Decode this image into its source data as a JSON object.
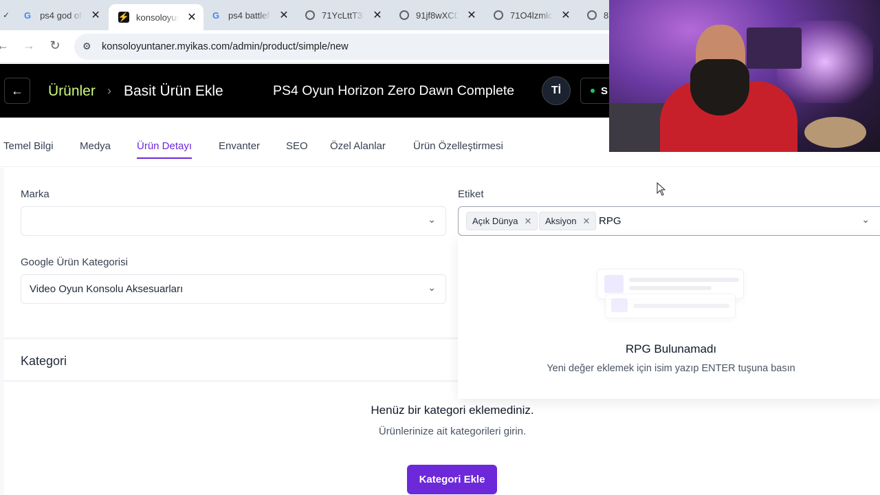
{
  "browser": {
    "tabs": [
      {
        "title": "ps4 god of",
        "favicon": "google-icon"
      },
      {
        "title": "konsoloyun",
        "favicon": "bolt-icon"
      },
      {
        "title": "ps4 battlef",
        "favicon": "google-icon"
      },
      {
        "title": "71YcLttT3S",
        "favicon": "globe-icon"
      },
      {
        "title": "91jf8wXCD",
        "favicon": "globe-icon"
      },
      {
        "title": "71O4lzmlc",
        "favicon": "globe-icon"
      },
      {
        "title": "8",
        "favicon": "globe-icon"
      }
    ],
    "url": "konsoloyuntaner.myikas.com/admin/product/simple/new"
  },
  "header": {
    "breadcrumb_root": "Ürünler",
    "breadcrumb_current": "Basit Ürün Ekle",
    "product_title": "PS4 Oyun Horizon Zero Dawn Complete",
    "avatar_initials": "Tİ",
    "status_label": "S",
    "accent_color": "#cdfa7a"
  },
  "tabs": {
    "items": [
      "Temel Bilgi",
      "Medya",
      "Ürün Detayı",
      "Envanter",
      "SEO",
      "Özel Alanlar",
      "Ürün Özelleştirmesi"
    ],
    "active": "Ürün Detayı",
    "active_color": "#6d28d9"
  },
  "form": {
    "brand_label": "Marka",
    "brand_value": "",
    "google_category_label": "Google Ürün Kategorisi",
    "google_category_value": "Video Oyun Konsolu Aksesuarları",
    "tag_label": "Etiket",
    "tags": [
      "Açık Dünya",
      "Aksiyon"
    ],
    "tag_input_value": "RPG"
  },
  "dropdown": {
    "title": "RPG Bulunamadı",
    "subtitle": "Yeni değer eklemek için isim yazıp ENTER tuşuna basın"
  },
  "category": {
    "section_title": "Kategori",
    "empty_title": "Henüz bir kategori eklemediniz.",
    "empty_subtitle": "Ürünlerinize ait kategorileri girin.",
    "add_button": "Kategori Ekle"
  }
}
